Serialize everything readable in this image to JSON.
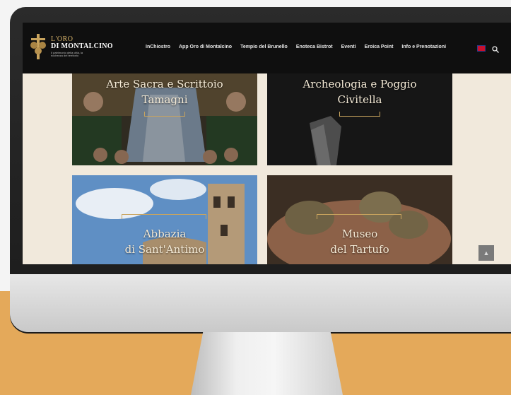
{
  "site": {
    "logo": {
      "line1": "L'ORO",
      "line2": "DI MONTALCINO",
      "tagline": "Il patrimonio della città, la ricchezza del territorio"
    },
    "nav_items": [
      "InChiostro",
      "App Oro di Montalcino",
      "Tempio del Brunello",
      "Enoteca Bistrot",
      "Eventi",
      "Eroica Point",
      "Info e Prenotazioni"
    ],
    "language_flag": "uk-flag",
    "search_icon": "search-icon"
  },
  "tiles": [
    {
      "title_l1": "Arte Sacra e Scrittoio",
      "title_l2": "Tamagni"
    },
    {
      "title_l1": "Archeologia e Poggio",
      "title_l2": "Civitella"
    },
    {
      "title_l1": "Abbazia",
      "title_l2": "di Sant'Antimo"
    },
    {
      "title_l1": "Museo",
      "title_l2": "del Tartufo"
    }
  ],
  "scroll_top_icon": "chevron-up-icon",
  "colors": {
    "accent_gold": "#c9a45e",
    "page_bg": "#f1e9dc",
    "nav_bg": "#0f0f0f",
    "backdrop": "#e4a95a"
  }
}
